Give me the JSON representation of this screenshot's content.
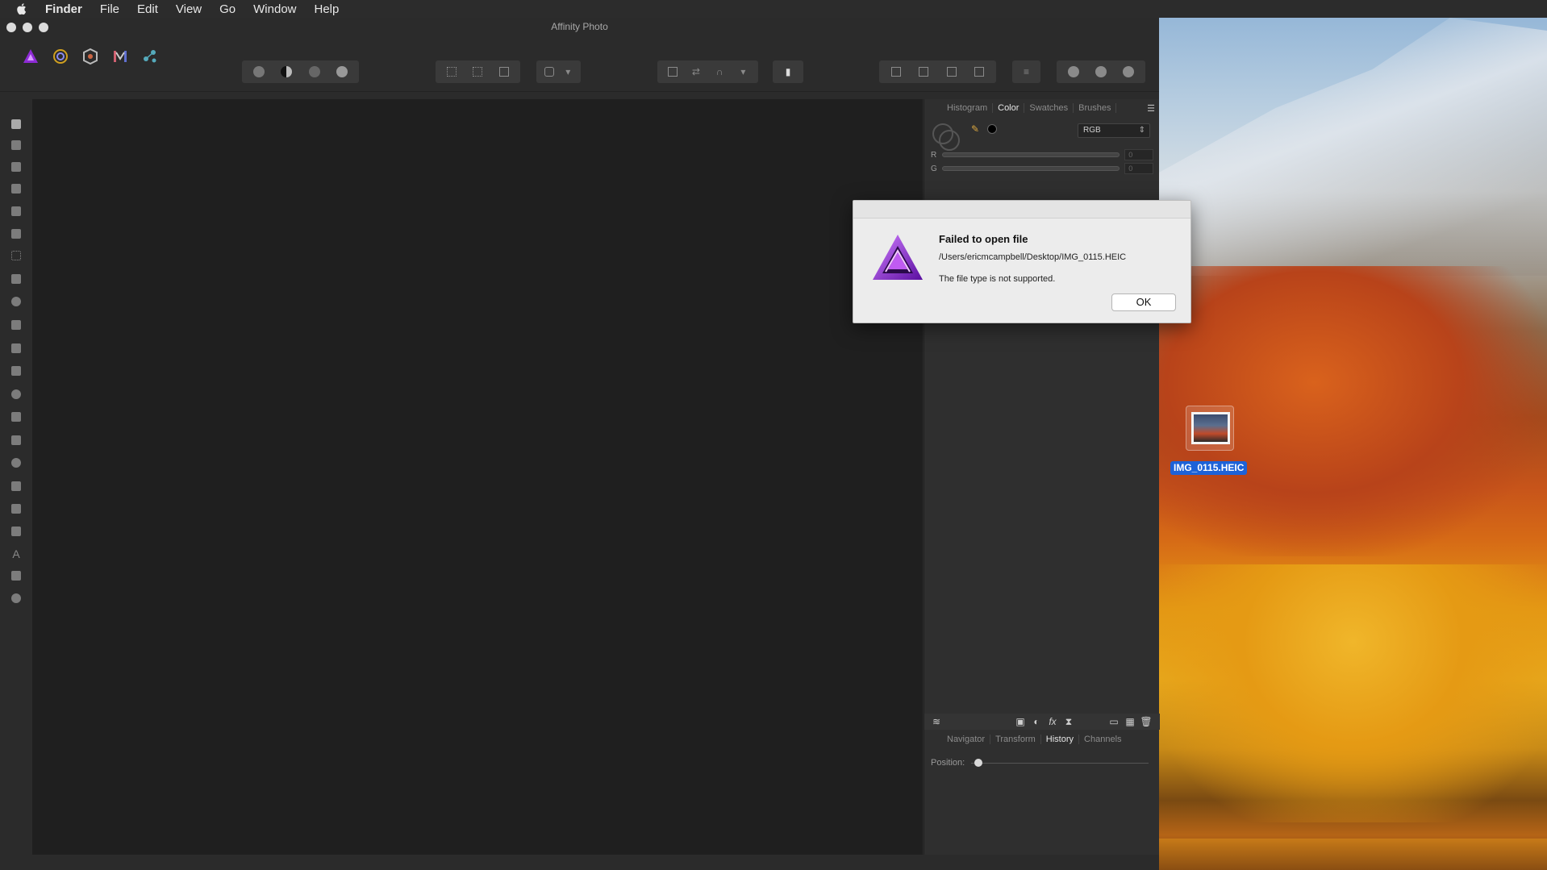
{
  "menubar": {
    "apple_icon": "apple-icon",
    "items": [
      "Finder",
      "File",
      "Edit",
      "View",
      "Go",
      "Window",
      "Help"
    ]
  },
  "window": {
    "title": "Affinity Photo"
  },
  "toolbar": {
    "personas": [
      "photo-persona-icon",
      "liquify-persona-icon",
      "develop-persona-icon",
      "tone-mapping-persona-icon",
      "export-persona-icon"
    ]
  },
  "color_panel": {
    "tabs": [
      "Histogram",
      "Color",
      "Swatches",
      "Brushes"
    ],
    "active_tab": "Color",
    "mode": "RGB",
    "channels": [
      {
        "label": "R",
        "value": "0"
      },
      {
        "label": "G",
        "value": "0"
      }
    ]
  },
  "history_panel": {
    "tabs": [
      "Navigator",
      "Transform",
      "History",
      "Channels"
    ],
    "active_tab": "History",
    "position_label": "Position:"
  },
  "desktop": {
    "file_name": "IMG_0115.HEIC"
  },
  "alert": {
    "title": "Failed to open file",
    "path": "/Users/ericmcampbell/Desktop/IMG_0115.HEIC",
    "message": "The file type is not supported.",
    "ok_label": "OK"
  },
  "colors": {
    "accent_purple": "#8e2bd6",
    "selection_blue": "#1d62d8",
    "canvas": "#1f1f1f"
  }
}
